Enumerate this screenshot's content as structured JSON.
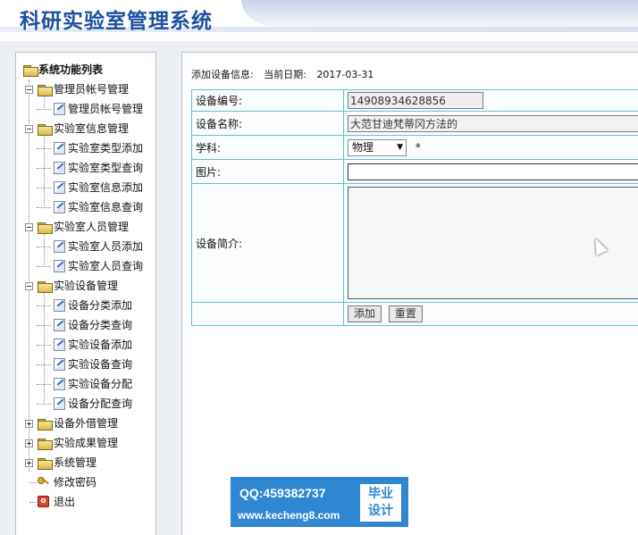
{
  "app": {
    "title": "科研实验室管理系统"
  },
  "nav": {
    "root_label": "系统功能列表",
    "groups": [
      {
        "label": "管理员帐号管理",
        "expanded": true,
        "items": [
          {
            "label": "管理员帐号管理"
          }
        ]
      },
      {
        "label": "实验室信息管理",
        "expanded": true,
        "items": [
          {
            "label": "实验室类型添加"
          },
          {
            "label": "实验室类型查询"
          },
          {
            "label": "实验室信息添加"
          },
          {
            "label": "实验室信息查询"
          }
        ]
      },
      {
        "label": "实验室人员管理",
        "expanded": true,
        "items": [
          {
            "label": "实验室人员添加"
          },
          {
            "label": "实验室人员查询"
          }
        ]
      },
      {
        "label": "实验设备管理",
        "expanded": true,
        "items": [
          {
            "label": "设备分类添加"
          },
          {
            "label": "设备分类查询"
          },
          {
            "label": "实验设备添加"
          },
          {
            "label": "实验设备查询"
          },
          {
            "label": "实验设备分配"
          },
          {
            "label": "设备分配查询"
          }
        ]
      },
      {
        "label": "设备外借管理",
        "expanded": false
      },
      {
        "label": "实验成果管理",
        "expanded": false
      },
      {
        "label": "系统管理",
        "expanded": false
      }
    ],
    "change_password": "修改密码",
    "logout": "退出"
  },
  "main": {
    "heading": "添加设备信息:",
    "date_label": "当前日期:",
    "date_value": "2017-03-31",
    "form": {
      "device_no_label": "设备编号:",
      "device_no_value": "14908934628856",
      "device_name_label": "设备名称:",
      "device_name_value": "大范甘迪梵蒂冈方法的",
      "subject_label": "学科:",
      "subject_value": "物理",
      "subject_required": "*",
      "image_label": "图片:",
      "image_value": "",
      "intro_label": "设备简介:",
      "intro_value": "",
      "add_button": "添加",
      "reset_button": "重置"
    }
  },
  "watermark": {
    "qq": "QQ:459382737",
    "url": "www.kecheng8.com",
    "badge_line1": "毕业",
    "badge_line2": "设计"
  }
}
